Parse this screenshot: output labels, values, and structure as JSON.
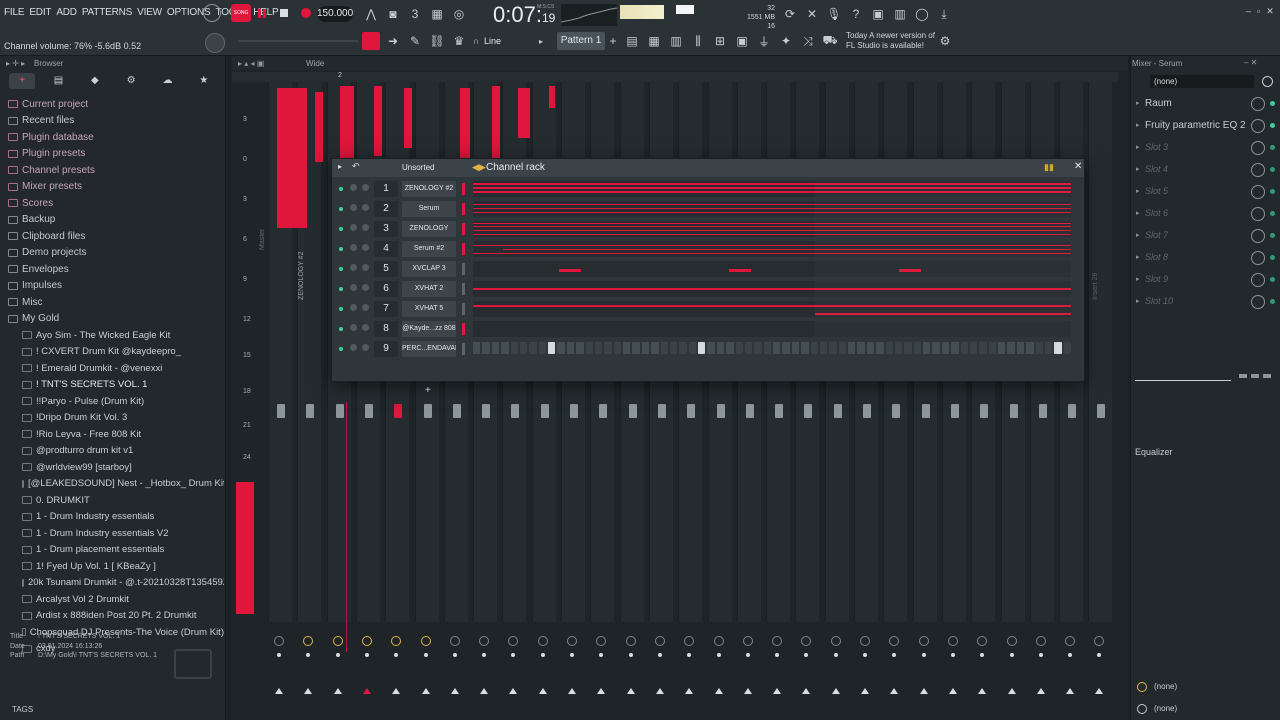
{
  "menu": [
    "FILE",
    "EDIT",
    "ADD",
    "PATTERNS",
    "VIEW",
    "OPTIONS",
    "TOOLS",
    "HELP"
  ],
  "transport": {
    "bpm": "150.000",
    "time": "0:07",
    "time_small": "19",
    "time_unit": "M:S:CS",
    "song_label": "SONG"
  },
  "cpu": {
    "top": "32",
    "mem": "1551 MB",
    "poly": "16"
  },
  "hint": "Channel volume: 76%  -5.6dB  0.52",
  "pattern": "Pattern 1",
  "snap": "Line",
  "news": {
    "line1": "Today  A newer version of",
    "line2": "FL Studio is available!"
  },
  "browser": {
    "title": "Browser",
    "tabs": [
      "+",
      "▤",
      "◆",
      "⚙",
      "☁",
      "★"
    ],
    "items": [
      {
        "label": "Current project",
        "level": 0,
        "accent": true
      },
      {
        "label": "Recent files",
        "level": 0
      },
      {
        "label": "Plugin database",
        "level": 0,
        "accent": true
      },
      {
        "label": "Plugin presets",
        "level": 0,
        "accent": true
      },
      {
        "label": "Channel presets",
        "level": 0,
        "accent": true
      },
      {
        "label": "Mixer presets",
        "level": 0,
        "accent": true
      },
      {
        "label": "Scores",
        "level": 0,
        "accent": true
      },
      {
        "label": "Backup",
        "level": 0
      },
      {
        "label": "Clipboard files",
        "level": 0
      },
      {
        "label": "Demo projects",
        "level": 0
      },
      {
        "label": "Envelopes",
        "level": 0
      },
      {
        "label": "Impulses",
        "level": 0
      },
      {
        "label": "Misc",
        "level": 0
      },
      {
        "label": "My Gold",
        "level": 0,
        "open": true
      },
      {
        "label": "Ayo Sim - The Wicked Eagle Kit",
        "level": 1
      },
      {
        "label": "! CXVERT Drum Kit @kaydeepro_",
        "level": 1
      },
      {
        "label": "! Emerald Drumkit - @venexxi",
        "level": 1
      },
      {
        "label": "! TNT'S SECRETS VOL. 1",
        "level": 1,
        "selected": true
      },
      {
        "label": "!!Paryo - Pulse (Drum Kit)",
        "level": 1
      },
      {
        "label": "!Dripo Drum Kit Vol. 3",
        "level": 1
      },
      {
        "label": "!Rio Leyva - Free 808 Kit",
        "level": 1
      },
      {
        "label": "@prodturro drum kit v1",
        "level": 1
      },
      {
        "label": "@wrldview99 [starboy]",
        "level": 1
      },
      {
        "label": "[@LEAKEDSOUND] Nest - _Hotbox_ Drum Kit",
        "level": 1
      },
      {
        "label": "0. DRUMKIT",
        "level": 1
      },
      {
        "label": "1 - Drum Industry essentials",
        "level": 1
      },
      {
        "label": "1 - Drum Industry essentials V2",
        "level": 1
      },
      {
        "label": "1 - Drum placement essentials",
        "level": 1
      },
      {
        "label": "1! Fyed Up Vol. 1 [ KBeaZy ]",
        "level": 1
      },
      {
        "label": "20k Tsunami Drumkit - @.t-20210328T135459Z-001",
        "level": 1
      },
      {
        "label": "Arcalyst Vol 2 Drumkit",
        "level": 1
      },
      {
        "label": "Ardist x 888iden Post 20 Pt. 2 Drumkit",
        "level": 1
      },
      {
        "label": "Chopsquad DJ Presents-The Voice (Drum Kit)",
        "level": 1
      },
      {
        "label": "cxdy",
        "level": 1
      }
    ],
    "info": {
      "title_label": "Title",
      "title": "! TNT'S SECRETS VOL. 1",
      "date_label": "Date",
      "date": "03.01.2024 16:13:26",
      "path_label": "Path",
      "path": "D:\\My Gold\\! TNT'S SECRETS VOL. 1"
    },
    "tags": "TAGS"
  },
  "mixer": {
    "header": "Wide",
    "insert_a": "Master",
    "insert_b": "ZENOLOGY #2",
    "insert_c": "Insert 28",
    "scale": [
      "3",
      "0",
      "3",
      "6",
      "9",
      "12",
      "15",
      "18",
      "21",
      "24"
    ],
    "ruler": [
      "2"
    ]
  },
  "channel_rack": {
    "title": "Channel rack",
    "sort": "Unsorted",
    "channels": [
      {
        "num": "1",
        "name": "ZENOLOGY #2",
        "selected": true
      },
      {
        "num": "2",
        "name": "Serum",
        "selected": true
      },
      {
        "num": "3",
        "name": "ZENOLOGY",
        "selected": true
      },
      {
        "num": "4",
        "name": "Serum #2",
        "selected": true
      },
      {
        "num": "5",
        "name": "XVCLAP 3",
        "selected": false
      },
      {
        "num": "6",
        "name": "XVHAT 2",
        "selected": false
      },
      {
        "num": "7",
        "name": "XVHAT 5",
        "selected": false
      },
      {
        "num": "8",
        "name": "@Kayde...zz 808",
        "selected": true
      },
      {
        "num": "9",
        "name": "PERC...ENDAVAR",
        "selected": false
      }
    ]
  },
  "right_panel": {
    "title": "Mixer - Serum",
    "input": "(none)",
    "slots": [
      "Raum",
      "Fruity parametric EQ 2",
      "Slot 3",
      "Slot 4",
      "Slot 5",
      "Slot 6",
      "Slot 7",
      "Slot 8",
      "Slot 9",
      "Slot 10"
    ],
    "eq_label": "Equalizer",
    "out1": "(none)",
    "out2": "(none)"
  },
  "colors": {
    "accent": "#e0163c",
    "led": "#3fcf9a",
    "bg": "#1c2125"
  }
}
